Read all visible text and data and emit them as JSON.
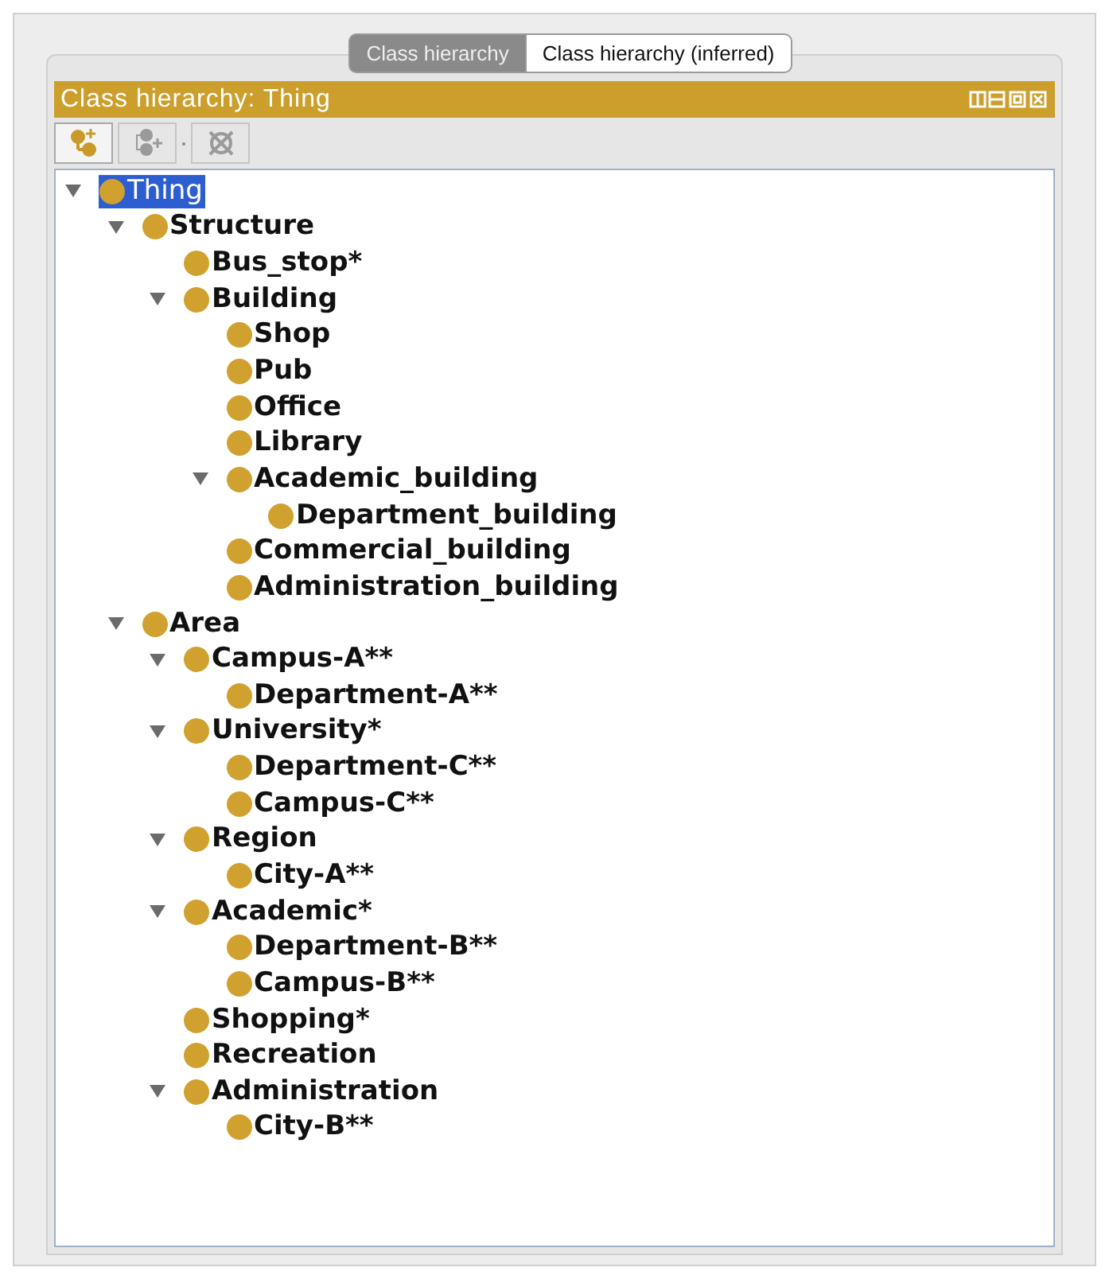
{
  "tabs": [
    {
      "label": "Class hierarchy",
      "selected": true
    },
    {
      "label": "Class hierarchy (inferred)",
      "selected": false
    }
  ],
  "panel": {
    "title": "Class hierarchy: Thing"
  },
  "tree": [
    {
      "label": "Thing",
      "selected": true,
      "expanded": true,
      "children": [
        {
          "label": "Structure",
          "selected": false,
          "expanded": true,
          "children": [
            {
              "label": "Bus_stop*",
              "selected": false
            },
            {
              "label": "Building",
              "selected": false,
              "expanded": true,
              "children": [
                {
                  "label": "Shop",
                  "selected": false
                },
                {
                  "label": "Pub",
                  "selected": false
                },
                {
                  "label": "Office",
                  "selected": false
                },
                {
                  "label": "Library",
                  "selected": false
                },
                {
                  "label": "Academic_building",
                  "selected": false,
                  "expanded": true,
                  "children": [
                    {
                      "label": "Department_building",
                      "selected": false
                    }
                  ]
                },
                {
                  "label": "Commercial_building",
                  "selected": false
                },
                {
                  "label": "Administration_building",
                  "selected": false
                }
              ]
            }
          ]
        },
        {
          "label": "Area",
          "selected": false,
          "expanded": true,
          "children": [
            {
              "label": "Campus-A**",
              "selected": false,
              "expanded": true,
              "children": [
                {
                  "label": "Department-A**",
                  "selected": false
                }
              ]
            },
            {
              "label": "University*",
              "selected": false,
              "expanded": true,
              "children": [
                {
                  "label": "Department-C**",
                  "selected": false
                },
                {
                  "label": "Campus-C**",
                  "selected": false
                }
              ]
            },
            {
              "label": "Region",
              "selected": false,
              "expanded": true,
              "children": [
                {
                  "label": "City-A**",
                  "selected": false
                }
              ]
            },
            {
              "label": "Academic*",
              "selected": false,
              "expanded": true,
              "children": [
                {
                  "label": "Department-B**",
                  "selected": false
                },
                {
                  "label": "Campus-B**",
                  "selected": false
                }
              ]
            },
            {
              "label": "Shopping*",
              "selected": false
            },
            {
              "label": "Recreation",
              "selected": false
            },
            {
              "label": "Administration",
              "selected": false,
              "expanded": true,
              "children": [
                {
                  "label": "City-B**",
                  "selected": false
                }
              ]
            }
          ]
        }
      ]
    }
  ]
}
